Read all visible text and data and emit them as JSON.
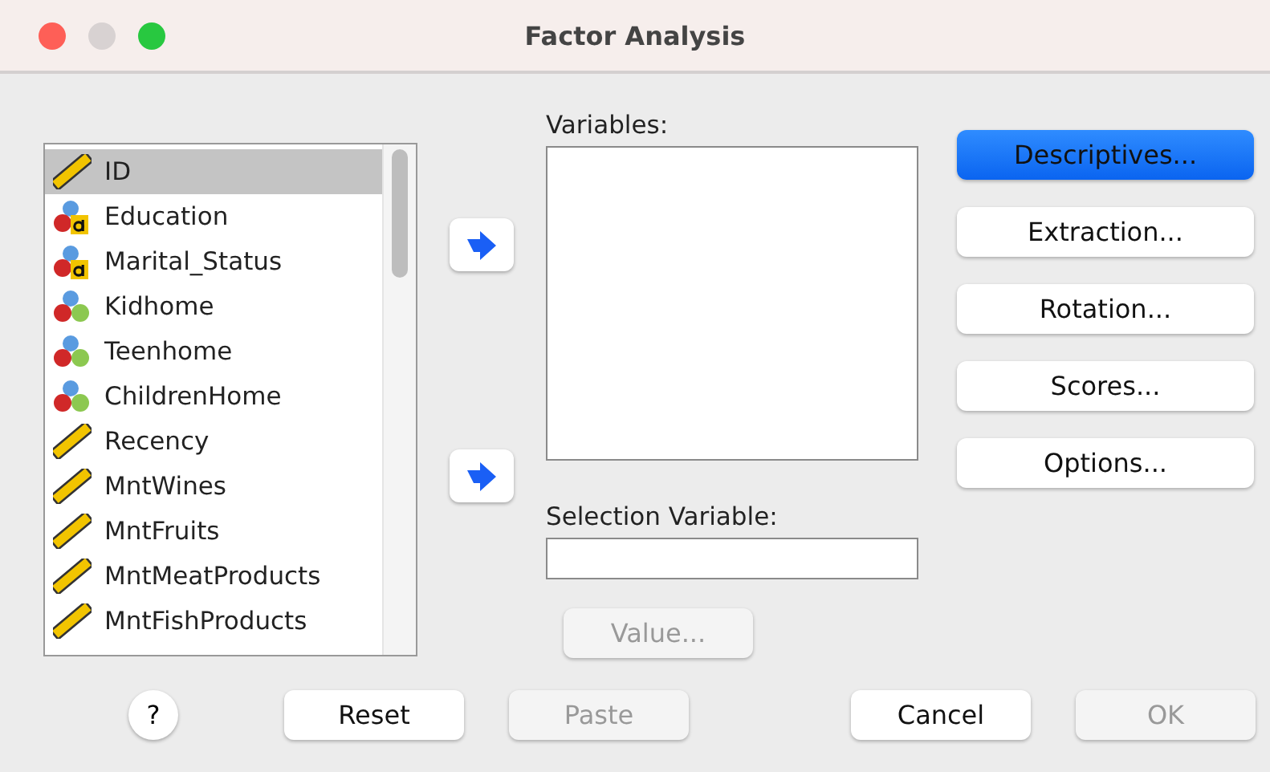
{
  "window": {
    "title": "Factor Analysis"
  },
  "source_list": [
    {
      "name": "ID",
      "kind": "scale",
      "selected": true
    },
    {
      "name": "Education",
      "kind": "nominal-string",
      "selected": false
    },
    {
      "name": "Marital_Status",
      "kind": "nominal-string",
      "selected": false
    },
    {
      "name": "Kidhome",
      "kind": "nominal",
      "selected": false
    },
    {
      "name": "Teenhome",
      "kind": "nominal",
      "selected": false
    },
    {
      "name": "ChildrenHome",
      "kind": "nominal",
      "selected": false
    },
    {
      "name": "Recency",
      "kind": "scale",
      "selected": false
    },
    {
      "name": "MntWines",
      "kind": "scale",
      "selected": false
    },
    {
      "name": "MntFruits",
      "kind": "scale",
      "selected": false
    },
    {
      "name": "MntMeatProducts",
      "kind": "scale",
      "selected": false
    },
    {
      "name": "MntFishProducts",
      "kind": "scale",
      "selected": false
    }
  ],
  "variables": {
    "label": "Variables:"
  },
  "selection_variable": {
    "label": "Selection Variable:",
    "value_button": {
      "label": "Value...",
      "disabled": true
    }
  },
  "side_buttons": [
    {
      "label": "Descriptives...",
      "default": true
    },
    {
      "label": "Extraction...",
      "default": false
    },
    {
      "label": "Rotation...",
      "default": false
    },
    {
      "label": "Scores...",
      "default": false
    },
    {
      "label": "Options...",
      "default": false
    }
  ],
  "help": {
    "label": "?"
  },
  "bottom_buttons": [
    {
      "label": "Reset",
      "disabled": false
    },
    {
      "label": "Paste",
      "disabled": true
    },
    {
      "label": "Cancel",
      "disabled": false
    },
    {
      "label": "OK",
      "disabled": true
    }
  ]
}
